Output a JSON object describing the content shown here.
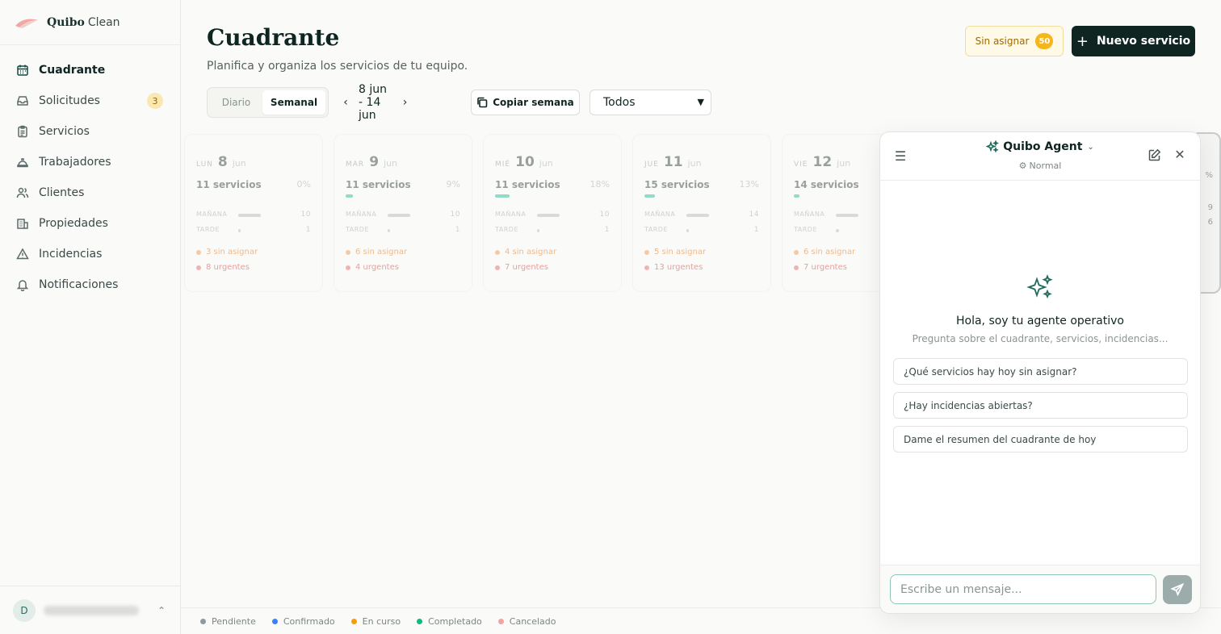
{
  "brand": {
    "name": "Quibo",
    "sub": "Clean"
  },
  "sidebar": {
    "items": [
      {
        "label": "Cuadrante",
        "icon": "calendar-icon",
        "active": true
      },
      {
        "label": "Solicitudes",
        "icon": "inbox-icon",
        "badge": "3"
      },
      {
        "label": "Servicios",
        "icon": "clipboard-icon"
      },
      {
        "label": "Trabajadores",
        "icon": "hardhat-icon"
      },
      {
        "label": "Clientes",
        "icon": "users-icon"
      },
      {
        "label": "Propiedades",
        "icon": "building-icon"
      },
      {
        "label": "Incidencias",
        "icon": "warning-icon"
      },
      {
        "label": "Notificaciones",
        "icon": "bell-icon"
      }
    ],
    "user_initial": "D"
  },
  "header": {
    "title": "Cuadrante",
    "subtitle": "Planifica y organiza los servicios de tu equipo.",
    "unassigned_label": "Sin asignar",
    "unassigned_count": "50",
    "new_service_label": "Nuevo servicio"
  },
  "toolbar": {
    "view_daily": "Diario",
    "view_weekly": "Semanal",
    "week_range": "8 jun - 14 jun",
    "copy_week": "Copiar semana",
    "filter_value": "Todos"
  },
  "days": [
    {
      "dow": "LUN",
      "num": "8",
      "month": "jun",
      "count": "11 servicios",
      "pct": "0%",
      "progress": 0,
      "morning_label": "MAÑANA",
      "morning": "10",
      "morning_frac": 1.0,
      "afternoon_label": "TARDE",
      "afternoon": "1",
      "afternoon_frac": 0.1,
      "unassigned": "3 sin asignar",
      "urgent": "8 urgentes"
    },
    {
      "dow": "MAR",
      "num": "9",
      "month": "jun",
      "count": "11 servicios",
      "pct": "9%",
      "progress": 0.09,
      "morning_label": "MAÑANA",
      "morning": "10",
      "morning_frac": 1.0,
      "afternoon_label": "TARDE",
      "afternoon": "1",
      "afternoon_frac": 0.1,
      "unassigned": "6 sin asignar",
      "urgent": "4 urgentes"
    },
    {
      "dow": "MIÉ",
      "num": "10",
      "month": "jun",
      "count": "11 servicios",
      "pct": "18%",
      "progress": 0.18,
      "morning_label": "MAÑANA",
      "morning": "10",
      "morning_frac": 1.0,
      "afternoon_label": "TARDE",
      "afternoon": "1",
      "afternoon_frac": 0.1,
      "unassigned": "4 sin asignar",
      "urgent": "7 urgentes"
    },
    {
      "dow": "JUE",
      "num": "11",
      "month": "jun",
      "count": "15 servicios",
      "pct": "13%",
      "progress": 0.13,
      "morning_label": "MAÑANA",
      "morning": "14",
      "morning_frac": 1.0,
      "afternoon_label": "TARDE",
      "afternoon": "1",
      "afternoon_frac": 0.07,
      "unassigned": "5 sin asignar",
      "urgent": "13 urgentes"
    },
    {
      "dow": "VIE",
      "num": "12",
      "month": "jun",
      "count": "14 servicios",
      "pct": "",
      "progress": 0.07,
      "morning_label": "MAÑANA",
      "morning": "",
      "morning_frac": 1.0,
      "afternoon_label": "TARDE",
      "afternoon": "",
      "afternoon_frac": 0.15,
      "unassigned": "6 sin asignar",
      "urgent": "7 urgentes"
    }
  ],
  "ghost": {
    "pct": "%",
    "a": "9",
    "b": "6"
  },
  "legend": [
    {
      "label": "Pendiente",
      "color": "#8e9aa0"
    },
    {
      "label": "Confirmado",
      "color": "#3b82f6"
    },
    {
      "label": "En curso",
      "color": "#f59e0b"
    },
    {
      "label": "Completado",
      "color": "#10b981"
    },
    {
      "label": "Cancelado",
      "color": "#f4a3a0"
    }
  ],
  "agent": {
    "title": "Quibo Agent",
    "mode": "Normal",
    "hello": "Hola, soy tu agente operativo",
    "hint": "Pregunta sobre el cuadrante, servicios, incidencias...",
    "suggestions": [
      "¿Qué servicios hay hoy sin asignar?",
      "¿Hay incidencias abiertas?",
      "Dame el resumen del cuadrante de hoy"
    ],
    "input_placeholder": "Escribe un mensaje..."
  }
}
